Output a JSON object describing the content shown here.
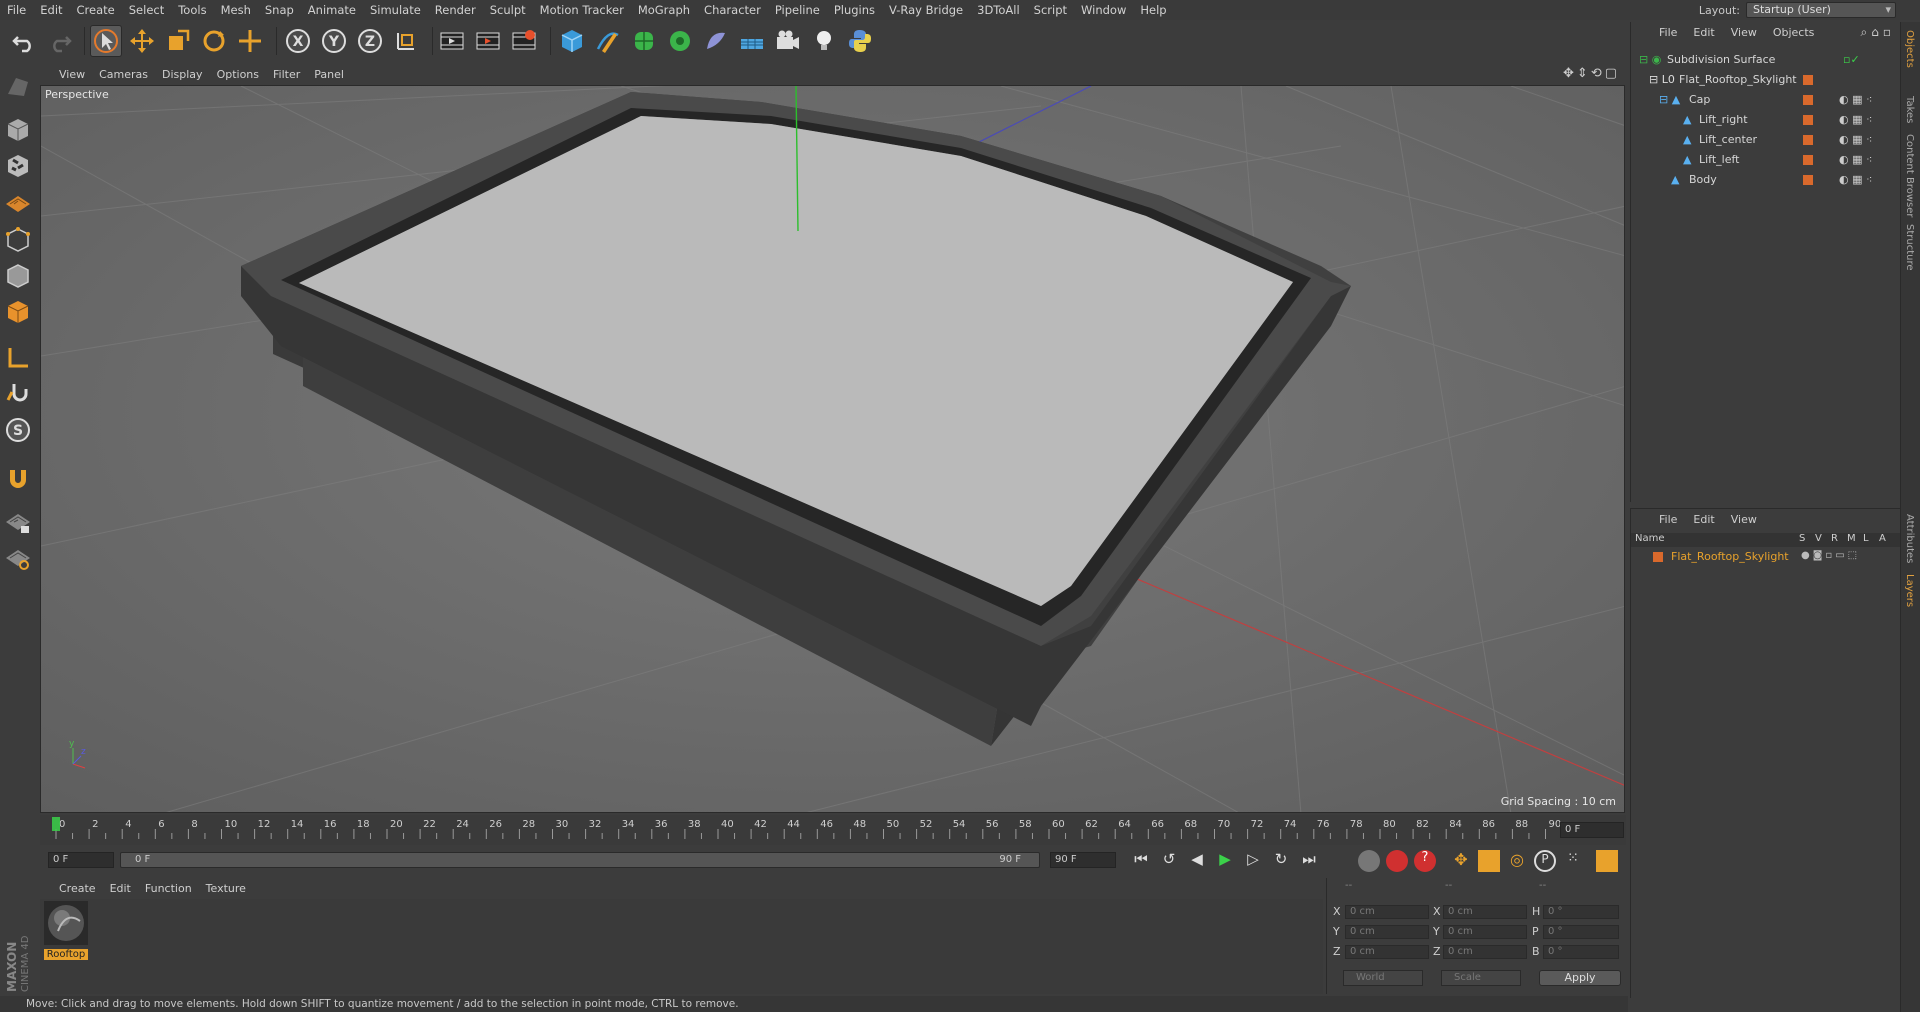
{
  "menubar": {
    "items": [
      "File",
      "Edit",
      "Create",
      "Select",
      "Tools",
      "Mesh",
      "Snap",
      "Animate",
      "Simulate",
      "Render",
      "Sculpt",
      "Motion Tracker",
      "MoGraph",
      "Character",
      "Pipeline",
      "Plugins",
      "V-Ray Bridge",
      "3DToAll",
      "Script",
      "Window",
      "Help"
    ],
    "layout_label": "Layout:",
    "layout_value": "Startup (User)"
  },
  "toolbar": {
    "icons": [
      "undo-icon",
      "redo-icon",
      "select-icon",
      "move-icon",
      "scale-icon",
      "rotate-icon",
      "move-plus-icon",
      "x-axis-icon",
      "y-axis-icon",
      "z-axis-icon",
      "coordinate-system-icon",
      "render-view-icon",
      "render-picture-icon",
      "render-settings-icon",
      "cube-icon",
      "pen-icon",
      "subdivision-icon",
      "cloner-icon",
      "deformer-icon",
      "floor-icon",
      "camera-icon",
      "light-icon",
      "python-icon"
    ]
  },
  "viewport": {
    "menu": [
      "View",
      "Cameras",
      "Display",
      "Options",
      "Filter",
      "Panel"
    ],
    "label": "Perspective",
    "grid_spacing": "Grid Spacing : 10 cm"
  },
  "timeline": {
    "ticks": [
      "0",
      "2",
      "4",
      "6",
      "8",
      "10",
      "12",
      "14",
      "16",
      "18",
      "20",
      "22",
      "24",
      "26",
      "28",
      "30",
      "32",
      "34",
      "36",
      "38",
      "40",
      "42",
      "44",
      "46",
      "48",
      "50",
      "52",
      "54",
      "56",
      "58",
      "60",
      "62",
      "64",
      "66",
      "68",
      "70",
      "72",
      "74",
      "76",
      "78",
      "80",
      "82",
      "84",
      "86",
      "88",
      "90"
    ],
    "current_frame": "0 F",
    "start_field": "0 F",
    "range_start": "0 F",
    "range_end": "90 F",
    "end_field": "90 F"
  },
  "material_manager": {
    "menu": [
      "Create",
      "Edit",
      "Function",
      "Texture"
    ],
    "material_name": "Rooftop"
  },
  "coordinates": {
    "header": [
      "--",
      "--",
      "--"
    ],
    "rows": [
      {
        "l1": "X",
        "v1": "0 cm",
        "l2": "X",
        "v2": "0 cm",
        "l3": "H",
        "v3": "0 °"
      },
      {
        "l1": "Y",
        "v1": "0 cm",
        "l2": "Y",
        "v2": "0 cm",
        "l3": "P",
        "v3": "0 °"
      },
      {
        "l1": "Z",
        "v1": "0 cm",
        "l2": "Z",
        "v2": "0 cm",
        "l3": "B",
        "v3": "0 °"
      }
    ],
    "mode": "World",
    "size_mode": "Scale",
    "apply": "Apply"
  },
  "status": "Move: Click and drag to move elements. Hold down SHIFT to quantize movement / add to the selection in point mode, CTRL to remove.",
  "object_manager": {
    "menu": [
      "File",
      "Edit",
      "View",
      "Objects"
    ],
    "objects": [
      {
        "name": "Subdivision Surface",
        "indent": 0
      },
      {
        "name": "Flat_Rooftop_Skylight",
        "indent": 1
      },
      {
        "name": "Cap",
        "indent": 2
      },
      {
        "name": "Lift_right",
        "indent": 3
      },
      {
        "name": "Lift_center",
        "indent": 3
      },
      {
        "name": "Lift_left",
        "indent": 3
      },
      {
        "name": "Body",
        "indent": 2
      }
    ]
  },
  "layer_manager": {
    "menu": [
      "File",
      "Edit",
      "View"
    ],
    "columns": [
      "Name",
      "S",
      "V",
      "R",
      "M",
      "L",
      "A"
    ],
    "layers": [
      {
        "name": "Flat_Rooftop_Skylight",
        "color": "#d9692c"
      }
    ]
  },
  "side_tabs": [
    "Objects",
    "Takes",
    "Content Browser",
    "Structure",
    "Attributes",
    "Layers"
  ],
  "colors": {
    "accent": "#d9692c",
    "viewport_bg": "#6e6e6e",
    "panel": "#3c3c3c"
  }
}
